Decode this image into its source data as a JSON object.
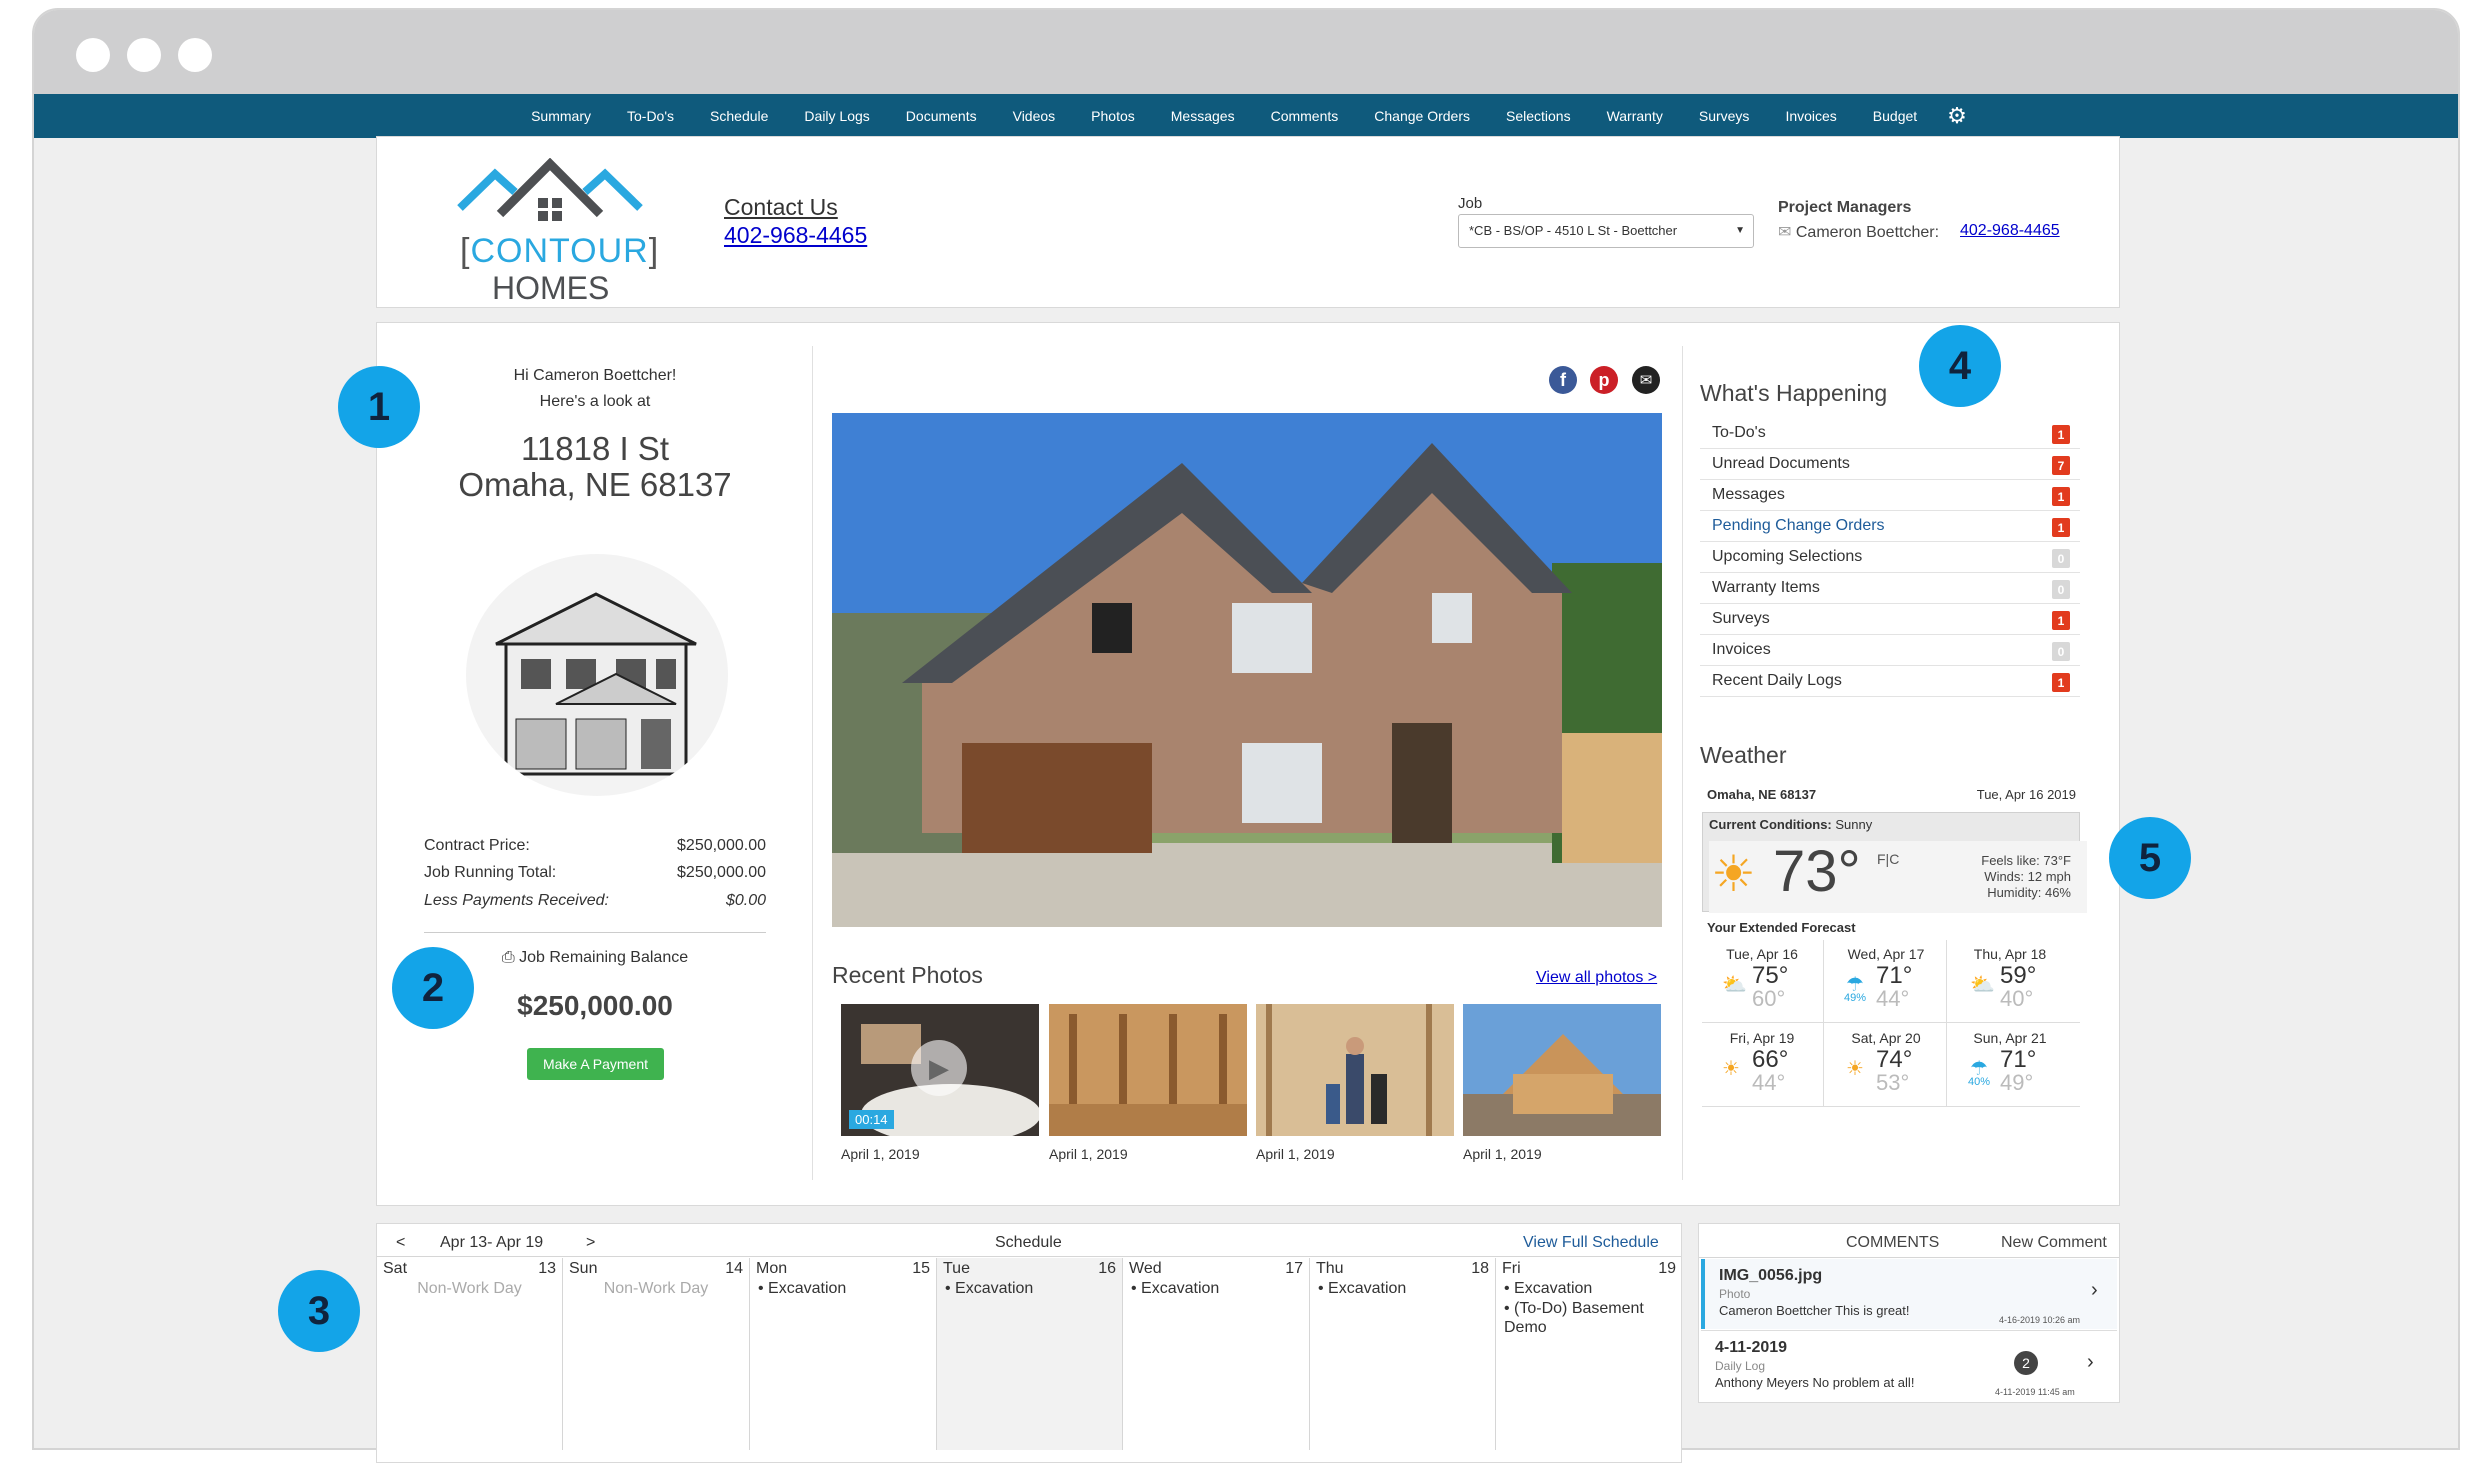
{
  "nav": {
    "items": [
      "Summary",
      "To-Do's",
      "Schedule",
      "Daily Logs",
      "Documents",
      "Videos",
      "Photos",
      "Messages",
      "Comments",
      "Change Orders",
      "Selections",
      "Warranty",
      "Surveys",
      "Invoices",
      "Budget"
    ],
    "settings_icon": "gear-icon"
  },
  "header": {
    "logo_line1": "CONTOUR",
    "logo_line2": "HOMES",
    "contact_label": "Contact Us",
    "contact_phone": "402-968-4465",
    "job_label": "Job",
    "job_value": "*CB - BS/OP - 4510 L St - Boettcher",
    "pm_label": "Project Managers",
    "pm_name": "Cameron Boettcher:",
    "pm_phone": "402-968-4465"
  },
  "markers": [
    "1",
    "2",
    "3",
    "4",
    "5"
  ],
  "left": {
    "greeting": "Hi Cameron Boettcher!",
    "subgreeting": "Here's a look at",
    "address1": "11818 I St",
    "address2": "Omaha, NE 68137",
    "rows": [
      {
        "label": "Contract Price:",
        "value": "$250,000.00"
      },
      {
        "label": "Job Running Total:",
        "value": "$250,000.00"
      },
      {
        "label": "Less Payments Received:",
        "value": "$0.00"
      }
    ],
    "balance_label": "Job Remaining Balance",
    "balance_value": "$250,000.00",
    "pay_button": "Make A Payment"
  },
  "center": {
    "recent_photos": "Recent Photos",
    "view_all": "View all photos >",
    "video_duration": "00:14",
    "photo_dates": [
      "April 1, 2019",
      "April 1, 2019",
      "April 1, 2019",
      "April 1, 2019"
    ]
  },
  "happening": {
    "title": "What's Happening",
    "items": [
      {
        "label": "To-Do's",
        "count": "1",
        "style": "red"
      },
      {
        "label": "Unread Documents",
        "count": "7",
        "style": "red"
      },
      {
        "label": "Messages",
        "count": "1",
        "style": "red"
      },
      {
        "label": "Pending Change Orders",
        "count": "1",
        "style": "red",
        "link": true
      },
      {
        "label": "Upcoming Selections",
        "count": "0",
        "style": "grey"
      },
      {
        "label": "Warranty Items",
        "count": "0",
        "style": "grey"
      },
      {
        "label": "Surveys",
        "count": "1",
        "style": "red"
      },
      {
        "label": "Invoices",
        "count": "0",
        "style": "grey"
      },
      {
        "label": "Recent Daily Logs",
        "count": "1",
        "style": "red"
      }
    ]
  },
  "weather": {
    "title": "Weather",
    "location": "Omaha, NE 68137",
    "date": "Tue, Apr 16 2019",
    "conditions_label": "Current Conditions:",
    "conditions": "Sunny",
    "temp": "73°",
    "unit_toggle": "F|C",
    "feels_like": "Feels like: 73°F",
    "winds": "Winds: 12 mph",
    "humidity": "Humidity: 46%",
    "forecast_label": "Your Extended Forecast",
    "forecast": [
      {
        "day": "Tue, Apr 16",
        "hi": "75°",
        "lo": "60°",
        "icon": "partly-sunny",
        "pct": ""
      },
      {
        "day": "Wed, Apr 17",
        "hi": "71°",
        "lo": "44°",
        "icon": "rain",
        "pct": "49%"
      },
      {
        "day": "Thu, Apr 18",
        "hi": "59°",
        "lo": "40°",
        "icon": "partly-sunny",
        "pct": ""
      },
      {
        "day": "Fri, Apr 19",
        "hi": "66°",
        "lo": "44°",
        "icon": "sunny",
        "pct": ""
      },
      {
        "day": "Sat, Apr 20",
        "hi": "74°",
        "lo": "53°",
        "icon": "sunny",
        "pct": ""
      },
      {
        "day": "Sun, Apr 21",
        "hi": "71°",
        "lo": "49°",
        "icon": "rain",
        "pct": "40%"
      }
    ]
  },
  "schedule": {
    "prev": "<",
    "range": "Apr 13- Apr 19",
    "next": ">",
    "title": "Schedule",
    "view_full": "View Full Schedule",
    "days": [
      {
        "name": "Sat",
        "num": "13",
        "nonwork": "Non-Work Day",
        "events": []
      },
      {
        "name": "Sun",
        "num": "14",
        "nonwork": "Non-Work Day",
        "events": []
      },
      {
        "name": "Mon",
        "num": "15",
        "nonwork": "",
        "events": [
          "Excavation"
        ]
      },
      {
        "name": "Tue",
        "num": "16",
        "nonwork": "",
        "events": [
          "Excavation"
        ]
      },
      {
        "name": "Wed",
        "num": "17",
        "nonwork": "",
        "events": [
          "Excavation"
        ]
      },
      {
        "name": "Thu",
        "num": "18",
        "nonwork": "",
        "events": [
          "Excavation"
        ]
      },
      {
        "name": "Fri",
        "num": "19",
        "nonwork": "",
        "events": [
          "Excavation",
          "(To-Do) Basement Demo"
        ]
      }
    ]
  },
  "comments": {
    "title": "COMMENTS",
    "new": "New Comment",
    "items": [
      {
        "title": "IMG_0056.jpg",
        "type": "Photo",
        "text": "Cameron Boettcher This is great!",
        "time": "4-16-2019 10:26 am",
        "count": ""
      },
      {
        "title": "4-11-2019",
        "type": "Daily Log",
        "text": "Anthony Meyers No problem at all!",
        "time": "4-11-2019 11:45 am",
        "count": "2"
      }
    ]
  }
}
